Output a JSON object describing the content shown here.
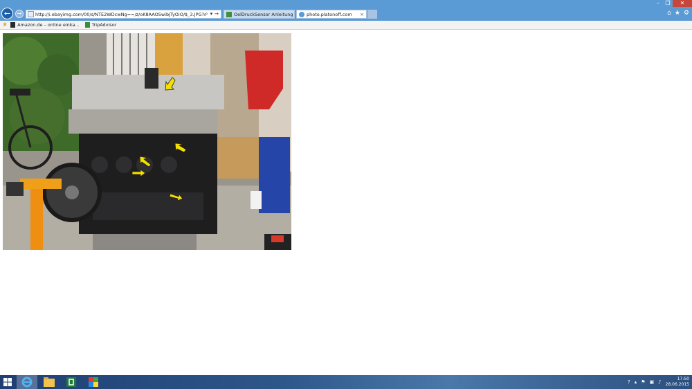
{
  "window": {
    "minimize": "–",
    "restore": "❐",
    "close": "✕"
  },
  "nav": {
    "back_icon": "arrow-left-icon",
    "forward_icon": "arrow-right-icon",
    "back_glyph": "←",
    "forward_glyph": "→"
  },
  "address": {
    "url": "http://i.ebayimg.com/00/s/NTE2WDcwNg==/z/oK8AAOSwibJTyOiO/$_3.JPG?set_id=2",
    "search_glyph": "⌕",
    "dropdown_glyph": "▾",
    "go_glyph": "→"
  },
  "tabs": [
    {
      "label": "OelDruckSensor Anleitung | Sa...",
      "active": false
    },
    {
      "label": "photo.platonoff.com",
      "active": true,
      "close": "×"
    }
  ],
  "toolbar_icons": {
    "home": "⌂",
    "favorites": "★",
    "settings": "⚙"
  },
  "favorites_bar": {
    "items": [
      {
        "label": "Amazon.de – online einka..."
      },
      {
        "label": "TripAdvisor"
      }
    ]
  },
  "taskbar": {
    "clock_time": "17:50",
    "clock_date": "28.06.2015"
  },
  "colors": {
    "titlebar": "#5b9bd5",
    "close_button": "#c7463c",
    "arrow_yellow": "#f4e000"
  }
}
